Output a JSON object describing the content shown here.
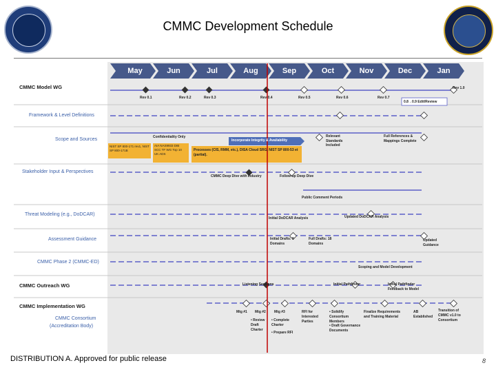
{
  "header": {
    "title": "CMMC Development Schedule"
  },
  "footer": {
    "distribution": "DISTRIBUTION A.  Approved for public release",
    "page": "8"
  },
  "months": [
    "May",
    "Jun",
    "Jul",
    "Aug",
    "Sep",
    "Oct",
    "Nov",
    "Dec",
    "Jan"
  ],
  "rows": {
    "model_wg": "CMMC Model WG",
    "framework": "Framework & Level Definitions",
    "scope": "Scope and Sources",
    "stakeholder": "Stakeholder Input & Perspectives",
    "threat": "Threat Modeling (e.g., DoDCAR)",
    "assessment": "Assessment Guidance",
    "phase2": "CMMC Phase 2 (CMMC-ED)",
    "outreach": "CMMC Outreach WG",
    "implementation": "CMMC Implementation WG",
    "consortium1": "CMMC Consortium",
    "consortium2": "(Accreditation Body)"
  },
  "labels": {
    "rev01": "Rev 0.1",
    "rev02": "Rev 0.2",
    "rev03": "Rev 0.3",
    "rev04": "Rev 0.4",
    "rev05": "Rev 0.5",
    "rev06": "Rev 0.6",
    "rev07": "Rev 0.7",
    "rev10": "Rev 1.0",
    "edit_review": "0.8→0.9 Edit/Review",
    "confidentiality": "Confidentiality Only",
    "nist": "NIST SP 800-171 rev1, NIST SP 800-171B",
    "aia": "AIA NAS9933 DIB SCC TF WG Top 10 UK ADS",
    "integrity": "Incorporate Integrity & Availability",
    "processes": "Processes (CIS, RMM, etc.), DISA Cloud SRG, NIST SP 800-53 et (partial).",
    "relevant": "Relevant Standards Included",
    "full_refs": "Full References & Mappings Complete",
    "deep_dive": "CMMC Deep Dive with Industry",
    "followup": "Follow-up Deep Dive",
    "public_comment": "Public Comment Periods",
    "initial_dodcar": "Initial DoDCAR Analysis",
    "updated_dodcar": "Updated DoDCAR Analysis",
    "initial_drafts": "Initial Drafts: 9 Domains",
    "full_drafts": "Full Drafts: 18 Domains",
    "updated_guidance": "Updated Guidance",
    "scoping": "Scoping and Model Development",
    "listening": "Listening Sessions",
    "initial_pathfinder": "Initial Pathfinder",
    "initial_pathfinder_feedback": "Initial Pathfinder Feedback to Model",
    "mtg1": "Mtg #1",
    "mtg2": "Mtg #2",
    "mtg3": "Mtg #3",
    "review_draft": "• Review Draft Charter",
    "complete_charter": "• Complete Charter",
    "prepare_rfi": "• Prepare RFI",
    "rfi": "RFI for Interested Parties",
    "solidify": "• Solidify Consortium Members",
    "draft_gov": "• Draft Governance Documents",
    "finalize": "Finalize Requirements and Training Material",
    "ab_established": "AB Established",
    "transition": "Transition of CMMC v1.0 to Consortium"
  },
  "colors": {
    "chevron": "#46598a",
    "track": "#5b5fc7",
    "today": "#c00000",
    "highlight": "#f2b233"
  }
}
